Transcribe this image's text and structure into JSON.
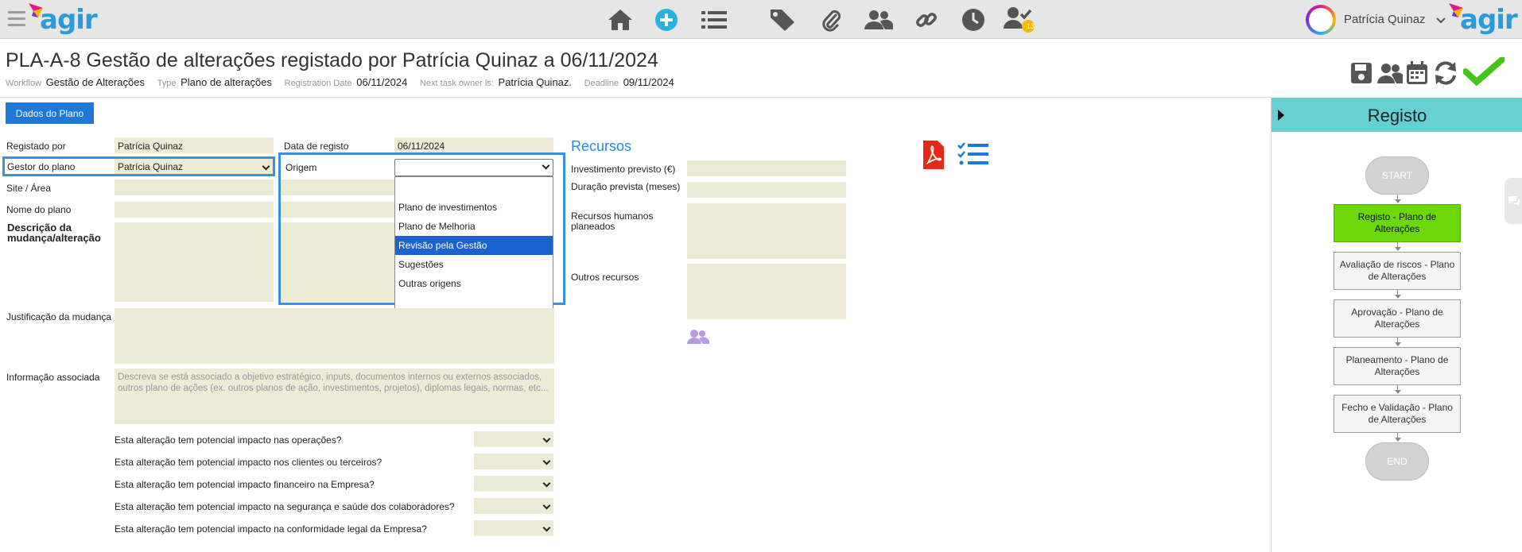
{
  "header": {
    "logo_text": "agir",
    "user_name": "Patrícia Quinaz",
    "notification_count": "13",
    "nav_icons": [
      "home-icon",
      "add-icon",
      "list-icon",
      "tags-icon",
      "paperclip-icon",
      "users-icon",
      "link-icon",
      "clock-icon",
      "user-check-icon"
    ]
  },
  "page": {
    "title": "PLA-A-8 Gestão de alterações registado por Patrícia Quinaz a 06/11/2024",
    "meta": [
      {
        "key": "Workflow",
        "value": "Gestão de Alterações"
      },
      {
        "key": "Type",
        "value": "Plano de alterações"
      },
      {
        "key": "Registration Date",
        "value": "06/11/2024"
      },
      {
        "key": "Next task owner is:",
        "value": "Patrícia Quinaz."
      },
      {
        "key": "Deadline",
        "value": "09/11/2024"
      }
    ],
    "action_icons": [
      "save-icon",
      "users-icon",
      "calendar-icon",
      "refresh-icon",
      "check-icon"
    ]
  },
  "form": {
    "tab_label": "Dados do Plano",
    "registado_por_label": "Registado por",
    "registado_por_value": "Patrícia Quinaz",
    "data_registo_label": "Data de registo",
    "data_registo_value": "06/11/2024",
    "gestor_label": "Gestor do plano",
    "gestor_value": "Patrícia Quinaz",
    "origem_label": "Origem",
    "origem_value": "",
    "origem_options": [
      "",
      "Plano de investimentos",
      "Plano de Melhoria",
      "Revisão pela Gestão",
      "Sugestões",
      "Outras origens"
    ],
    "origem_highlighted": "Revisão pela Gestão",
    "site_label": "Site / Área",
    "nome_label": "Nome do plano",
    "descricao_label": "Descrição da mudança/alteração",
    "justificacao_label": "Justificação da mudança",
    "informacao_label": "Informação associada",
    "informacao_placeholder": "Descreva se está associado a objetivo estratégico, inputs, documentos internos ou externos associados, outros plano de ações (ex. outros planos de ação, investimentos, projetos), diplomas legais, normas, etc...",
    "questions": [
      "Esta alteração tem potencial impacto nas operações?",
      "Esta alteração tem potencial impacto nos clientes ou terceiros?",
      "Esta alteração tem potencial impacto financeiro na Empresa?",
      "Esta alteração tem potencial impacto na segurança e saúde dos colaboradores?",
      "Esta alteração tem potencial impacto na conformidade legal da Empresa?"
    ]
  },
  "recursos": {
    "title": "Recursos",
    "investimento_label": "Investimento previsto (€)",
    "duracao_label": "Duração prevista (meses)",
    "humanos_label": "Recursos humanos planeados",
    "outros_label": "Outros recursos"
  },
  "workflow": {
    "title": "Registo",
    "start": "START",
    "end": "END",
    "steps": [
      "Registo - Plano de Alterações",
      "Avaliação de riscos - Plano de Alterações",
      "Aprovação - Plano de Alterações",
      "Planeamento - Plano de Alterações",
      "Fecho e Validação - Plano de Alterações"
    ],
    "active_step": "Registo - Plano de Alterações"
  },
  "colors": {
    "accent": "#1f78d8",
    "field_bg": "#ebebd6",
    "active_step": "#6ad80b",
    "sidebar_header": "#66cfd0",
    "check": "#45c41a"
  }
}
